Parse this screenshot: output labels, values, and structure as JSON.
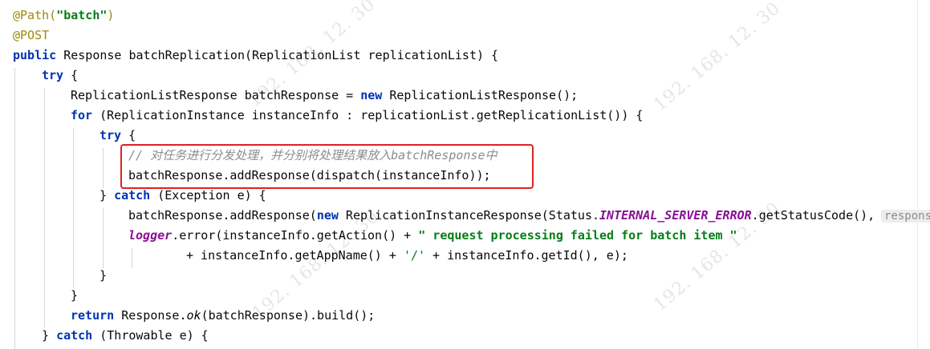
{
  "watermark": "192. 168. 12. 30",
  "code": {
    "l1_ann": "@Path(",
    "l1_str": "\"batch\"",
    "l1_close": ")",
    "l2_ann": "@POST",
    "l3_kw": "public",
    "l3_rest": " Response batchReplication(ReplicationList replicationList) {",
    "l4_kw": "try",
    "l4_rest": " {",
    "l5_a": "ReplicationListResponse batchResponse = ",
    "l5_kw": "new",
    "l5_b": " ReplicationListResponse();",
    "l6_kw": "for",
    "l6_rest": " (ReplicationInstance instanceInfo : replicationList.getReplicationList()) {",
    "l7_kw": "try",
    "l7_rest": " {",
    "l8_comment": "// 对任务进行分发处理，并分别将处理结果放入batchResponse中",
    "l9": "batchResponse.addResponse(dispatch(instanceInfo));",
    "l10_a": "} ",
    "l10_kw": "catch",
    "l10_b": " (Exception e) {",
    "l11_a": "batchResponse.addResponse(",
    "l11_kw": "new",
    "l11_b": " ReplicationInstanceResponse(Status.",
    "l11_static": "INTERNAL_SERVER_ERROR",
    "l11_c": ".getStatusCode(),",
    "l11_hint": "respons",
    "l12_field": "logger",
    "l12_a": ".error(instanceInfo.getAction() + ",
    "l12_str": "\" request processing failed for batch item \"",
    "l13_a": "+ instanceInfo.getAppName() + ",
    "l13_chr": "'/'",
    "l13_b": " + instanceInfo.getId(), e);",
    "l14": "}",
    "l15": "}",
    "l16_kw": "return",
    "l16_a": " Response.",
    "l16_italic": "ok",
    "l16_b": "(batchResponse).build();",
    "l17_a": "} ",
    "l17_kw": "catch",
    "l17_b": " (Throwable e) {"
  }
}
